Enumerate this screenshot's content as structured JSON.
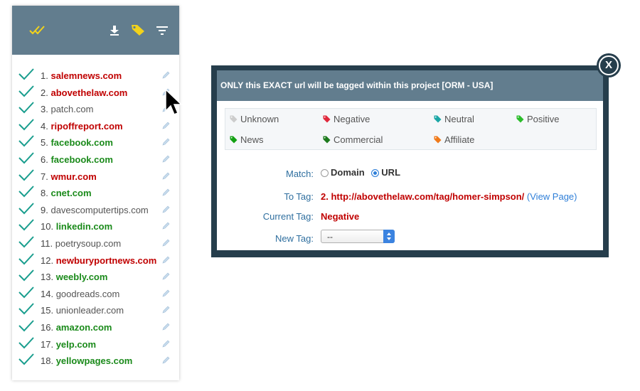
{
  "colors": {
    "green": "#1a8a1a",
    "red": "#c00000",
    "gray": "#555555",
    "header": "#627d8e",
    "dialog_border": "#263e4c"
  },
  "sidebar": {
    "header_icons": [
      "double-check-icon",
      "download-icon",
      "tag-icon",
      "filter-icon"
    ],
    "items": [
      {
        "num": "1.",
        "site": "salemnews.com",
        "status": "red"
      },
      {
        "num": "2.",
        "site": "abovethelaw.com",
        "status": "red"
      },
      {
        "num": "3.",
        "site": "patch.com",
        "status": "gray"
      },
      {
        "num": "4.",
        "site": "ripoffreport.com",
        "status": "red"
      },
      {
        "num": "5.",
        "site": "facebook.com",
        "status": "green"
      },
      {
        "num": "6.",
        "site": "facebook.com",
        "status": "green"
      },
      {
        "num": "7.",
        "site": "wmur.com",
        "status": "red"
      },
      {
        "num": "8.",
        "site": "cnet.com",
        "status": "green"
      },
      {
        "num": "9.",
        "site": "davescomputertips.com",
        "status": "gray"
      },
      {
        "num": "10.",
        "site": "linkedin.com",
        "status": "green"
      },
      {
        "num": "11.",
        "site": "poetrysoup.com",
        "status": "gray"
      },
      {
        "num": "12.",
        "site": "newburyportnews.com",
        "status": "red"
      },
      {
        "num": "13.",
        "site": "weebly.com",
        "status": "green"
      },
      {
        "num": "14.",
        "site": "goodreads.com",
        "status": "gray"
      },
      {
        "num": "15.",
        "site": "unionleader.com",
        "status": "gray"
      },
      {
        "num": "16.",
        "site": "amazon.com",
        "status": "green"
      },
      {
        "num": "17.",
        "site": "yelp.com",
        "status": "green"
      },
      {
        "num": "18.",
        "site": "yellowpages.com",
        "status": "green"
      }
    ]
  },
  "dialog": {
    "title": "ONLY this EXACT url will be tagged within this project [ORM - USA]",
    "close_label": "X",
    "tags": [
      {
        "label": "Unknown",
        "color": "#cccccc"
      },
      {
        "label": "Negative",
        "color": "#e0283c"
      },
      {
        "label": "Neutral",
        "color": "#1aa6a6"
      },
      {
        "label": "Positive",
        "color": "#2bbd2b"
      },
      {
        "label": "News",
        "color": "#13a013"
      },
      {
        "label": "Commercial",
        "color": "#1d7a1d"
      },
      {
        "label": "Affiliate",
        "color": "#f07a1a"
      }
    ],
    "match_label": "Match:",
    "match_domain": "Domain",
    "match_url": "URL",
    "match_selected": "URL",
    "to_tag_label": "To Tag:",
    "to_tag_num": "2.",
    "to_tag_url": "http://abovethelaw.com/tag/homer-simpson/",
    "view_page": "(View Page)",
    "current_tag_label": "Current Tag:",
    "current_tag_value": "Negative",
    "new_tag_label": "New Tag:",
    "new_tag_value": "--"
  }
}
